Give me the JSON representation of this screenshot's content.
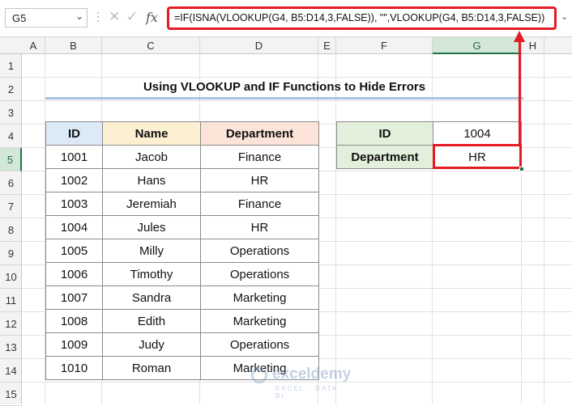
{
  "formula_bar": {
    "name_box": "G5",
    "formula": "=IF(ISNA(VLOOKUP(G4, B5:D14,3,FALSE)), \"\",VLOOKUP(G4, B5:D14,3,FALSE))"
  },
  "columns": [
    "A",
    "B",
    "C",
    "D",
    "E",
    "F",
    "G",
    "H"
  ],
  "rows": [
    "1",
    "2",
    "3",
    "4",
    "5",
    "6",
    "7",
    "8",
    "9",
    "10",
    "11",
    "12",
    "13",
    "14",
    "15"
  ],
  "title": "Using VLOOKUP and IF Functions to Hide Errors",
  "table": {
    "headers": [
      "ID",
      "Name",
      "Department"
    ],
    "header_colors": [
      "#dce9f6",
      "#fdf0d2",
      "#fbe4d7"
    ],
    "rows": [
      [
        "1001",
        "Jacob",
        "Finance"
      ],
      [
        "1002",
        "Hans",
        "HR"
      ],
      [
        "1003",
        "Jeremiah",
        "Finance"
      ],
      [
        "1004",
        "Jules",
        "HR"
      ],
      [
        "1005",
        "Milly",
        "Operations"
      ],
      [
        "1006",
        "Timothy",
        "Operations"
      ],
      [
        "1007",
        "Sandra",
        "Marketing"
      ],
      [
        "1008",
        "Edith",
        "Marketing"
      ],
      [
        "1009",
        "Judy",
        "Operations"
      ],
      [
        "1010",
        "Roman",
        "Marketing"
      ]
    ]
  },
  "lookup": {
    "id_label": "ID",
    "id_value": "1004",
    "dept_label": "Department",
    "dept_value": "HR",
    "label_color": "#e2efda"
  },
  "watermark": {
    "name": "exceldemy",
    "tagline": "EXCEL · DATA · BI"
  },
  "colors": {
    "accent": "#217346",
    "highlight": "#e41b23"
  }
}
